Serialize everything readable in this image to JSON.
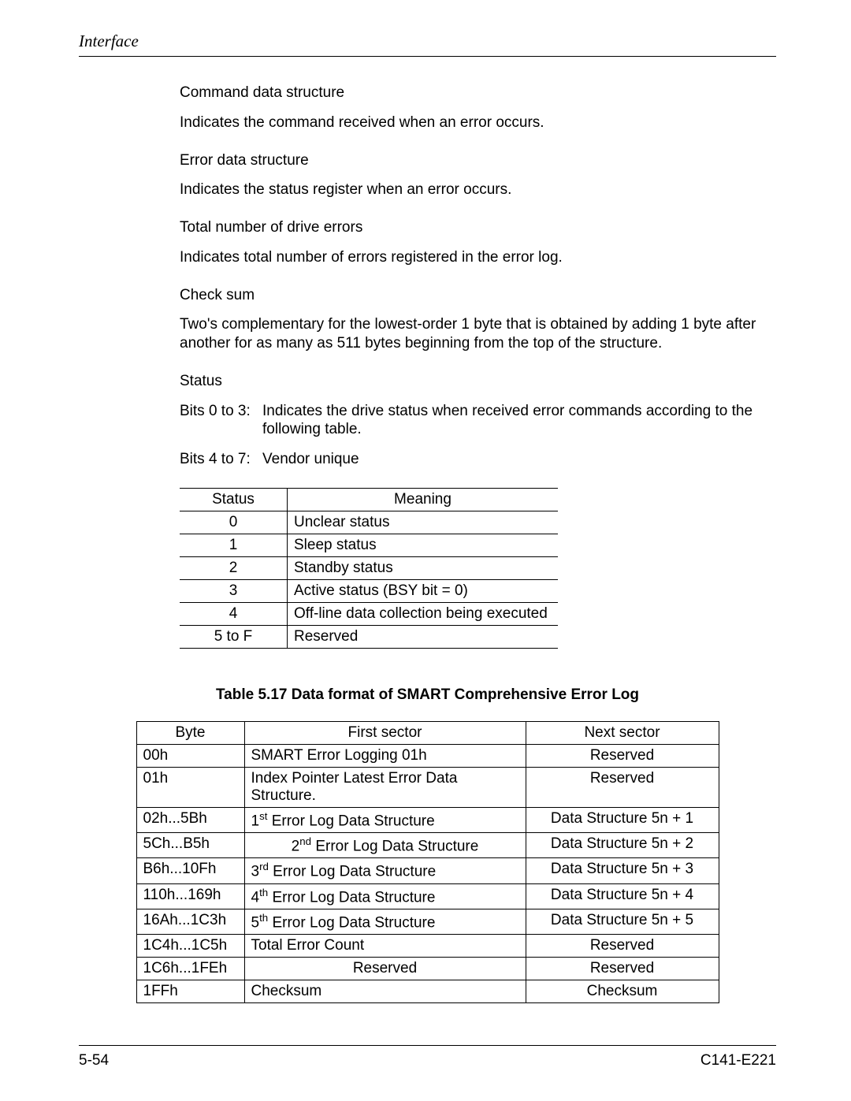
{
  "header": {
    "section": "Interface"
  },
  "definitions": [
    {
      "head": "Command data structure",
      "text": "Indicates the command received when an error occurs."
    },
    {
      "head": "Error data structure",
      "text": "Indicates the status register when an error occurs."
    },
    {
      "head": "Total number of drive errors",
      "text": "Indicates total number of errors registered in the error log."
    },
    {
      "head": "Check sum",
      "text": "Two's complementary for the lowest-order 1 byte that is obtained by adding 1 byte after another for as many as 511 bytes beginning from the top of the structure."
    }
  ],
  "status_section": {
    "head": "Status",
    "bits": [
      {
        "label": "Bits 0 to 3:",
        "text": "Indicates the drive status when received error commands according to the following table."
      },
      {
        "label": "Bits 4 to 7:",
        "text": "Vendor unique"
      }
    ]
  },
  "status_table": {
    "headers": [
      "Status",
      "Meaning"
    ],
    "rows": [
      {
        "status": "0",
        "meaning": "Unclear status"
      },
      {
        "status": "1",
        "meaning": "Sleep status"
      },
      {
        "status": "2",
        "meaning": "Standby status"
      },
      {
        "status": "3",
        "meaning": "Active status (BSY bit = 0)"
      },
      {
        "status": "4",
        "meaning": "Off-line data collection being executed"
      },
      {
        "status": "5 to F",
        "meaning": "Reserved"
      }
    ]
  },
  "caption": "Table 5.17  Data format of SMART Comprehensive Error Log",
  "chart_data": {
    "type": "table",
    "title": "Table 5.17  Data format of SMART Comprehensive Error Log",
    "columns": [
      "Byte",
      "First sector",
      "Next sector"
    ],
    "rows": [
      [
        "00h",
        "SMART Error Logging 01h",
        "Reserved"
      ],
      [
        "01h",
        "Index Pointer Latest Error Data Structure.",
        "Reserved"
      ],
      [
        "02h...5Bh",
        "1st Error Log Data Structure",
        "Data Structure 5n + 1"
      ],
      [
        "5Ch...B5h",
        "2nd Error Log Data Structure",
        "Data Structure 5n + 2"
      ],
      [
        "B6h...10Fh",
        "3rd Error Log Data Structure",
        "Data Structure 5n + 3"
      ],
      [
        "110h...169h",
        "4th Error Log Data Structure",
        "Data Structure 5n + 4"
      ],
      [
        "16Ah...1C3h",
        "5th Error Log Data Structure",
        "Data Structure 5n + 5"
      ],
      [
        "1C4h...1C5h",
        "Total Error Count",
        "Reserved"
      ],
      [
        "1C6h...1FEh",
        "Reserved",
        "Reserved"
      ],
      [
        "1FFh",
        "Checksum",
        "Checksum"
      ]
    ]
  },
  "data_table": {
    "headers": {
      "byte": "Byte",
      "first": "First sector",
      "next": "Next sector"
    },
    "rows": [
      {
        "byte": "00h",
        "first_pre": "",
        "first_sup": "",
        "first_post": "SMART Error Logging 01h",
        "next": "Reserved",
        "first_align": "pad-l",
        "next_align": "center"
      },
      {
        "byte": "01h",
        "first_pre": "",
        "first_sup": "",
        "first_post": "Index Pointer Latest Error Data Structure.",
        "next": "Reserved",
        "first_align": "pad-l",
        "next_align": "center"
      },
      {
        "byte": "02h...5Bh",
        "first_pre": "1",
        "first_sup": "st",
        "first_post": " Error Log Data Structure",
        "next": "Data Structure 5n + 1",
        "first_align": "pad-l",
        "next_align": "center"
      },
      {
        "byte": "5Ch...B5h",
        "first_pre": "2",
        "first_sup": "nd",
        "first_post": " Error Log Data Structure",
        "next": "Data Structure 5n + 2",
        "first_align": "center",
        "next_align": "center"
      },
      {
        "byte": "B6h...10Fh",
        "first_pre": "3",
        "first_sup": "rd",
        "first_post": " Error Log Data Structure",
        "next": "Data Structure 5n + 3",
        "first_align": "pad-l",
        "next_align": "center"
      },
      {
        "byte": "110h...169h",
        "first_pre": "4",
        "first_sup": "th",
        "first_post": " Error Log Data Structure",
        "next": "Data Structure 5n + 4",
        "first_align": "pad-l",
        "next_align": "center"
      },
      {
        "byte": "16Ah...1C3h",
        "first_pre": "5",
        "first_sup": "th",
        "first_post": " Error Log Data Structure",
        "next": "Data Structure 5n + 5",
        "first_align": "pad-l",
        "next_align": "center"
      },
      {
        "byte": "1C4h...1C5h",
        "first_pre": "",
        "first_sup": "",
        "first_post": "Total Error Count",
        "next": "Reserved",
        "first_align": "pad-l",
        "next_align": "center"
      },
      {
        "byte": "1C6h...1FEh",
        "first_pre": "",
        "first_sup": "",
        "first_post": "Reserved",
        "next": "Reserved",
        "first_align": "center",
        "next_align": "center"
      },
      {
        "byte": "1FFh",
        "first_pre": "",
        "first_sup": "",
        "first_post": "Checksum",
        "next": "Checksum",
        "first_align": "pad-l",
        "next_align": "center"
      }
    ]
  },
  "footer": {
    "page": "5-54",
    "doc": "C141-E221"
  }
}
